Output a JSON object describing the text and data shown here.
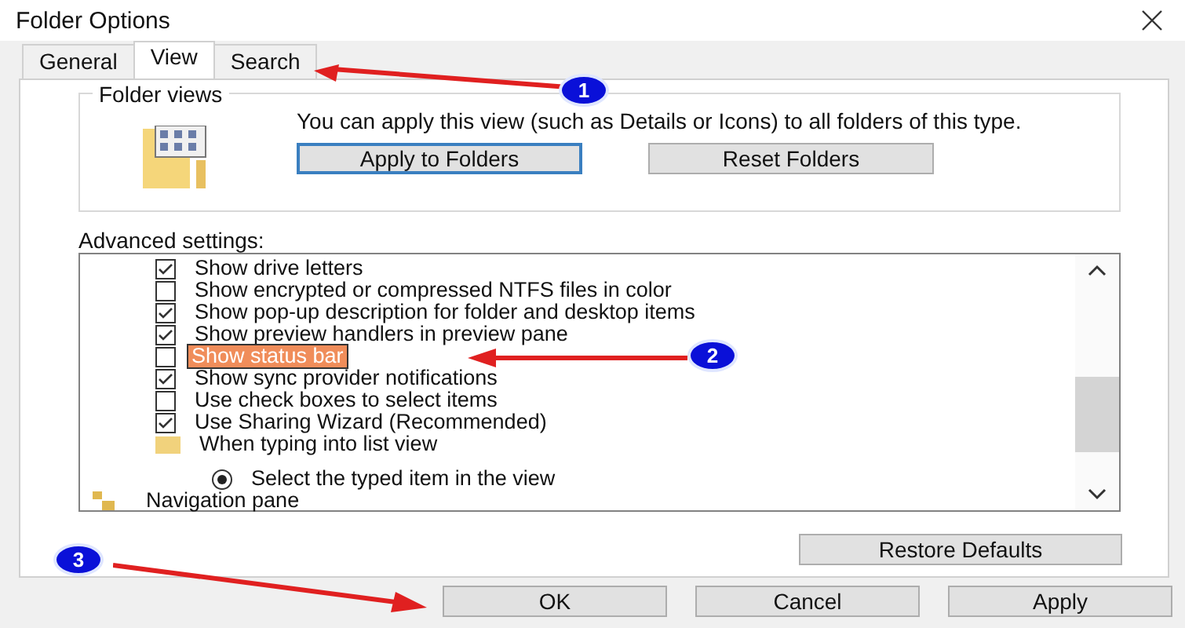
{
  "window": {
    "title": "Folder Options"
  },
  "tabs": [
    {
      "label": "General",
      "selected": false
    },
    {
      "label": "View",
      "selected": true
    },
    {
      "label": "Search",
      "selected": false
    }
  ],
  "folder_views": {
    "title": "Folder views",
    "description": "You can apply this view (such as Details or Icons) to all folders of this type.",
    "buttons": [
      "Apply to Folders",
      "Reset Folders"
    ]
  },
  "advanced_settings": {
    "label": "Advanced settings:",
    "items": [
      {
        "kind": "checkbox",
        "label": "Show drive letters",
        "checked": true,
        "selected": false
      },
      {
        "kind": "checkbox",
        "label": "Show encrypted or compressed NTFS files in color",
        "checked": false,
        "selected": false
      },
      {
        "kind": "checkbox",
        "label": "Show pop-up description for folder and desktop items",
        "checked": true,
        "selected": false
      },
      {
        "kind": "checkbox",
        "label": "Show preview handlers in preview pane",
        "checked": true,
        "selected": false
      },
      {
        "kind": "checkbox",
        "label": "Show status bar",
        "checked": false,
        "selected": true
      },
      {
        "kind": "checkbox",
        "label": "Show sync provider notifications",
        "checked": true,
        "selected": false
      },
      {
        "kind": "checkbox",
        "label": "Use check boxes to select items",
        "checked": false,
        "selected": false
      },
      {
        "kind": "checkbox",
        "label": "Use Sharing Wizard (Recommended)",
        "checked": true,
        "selected": false
      },
      {
        "kind": "folder",
        "label": "When typing into list view",
        "selected": false,
        "children": [
          {
            "kind": "radio",
            "label": "Select the typed item in the view",
            "checked": true,
            "selected": false
          }
        ]
      },
      {
        "kind": "navpane",
        "label": "Navigation pane",
        "selected": false
      }
    ],
    "restore_button": "Restore Defaults"
  },
  "buttons": [
    "OK",
    "Cancel",
    "Apply"
  ],
  "annotations": [
    "1",
    "2",
    "3"
  ]
}
